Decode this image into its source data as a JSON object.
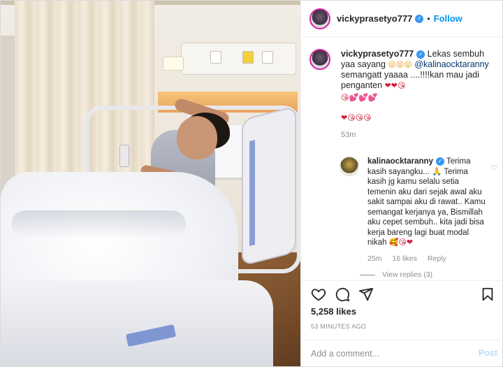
{
  "header": {
    "username": "vickyprasetyo777",
    "verified_glyph": "✓",
    "separator": "•",
    "follow_label": "Follow"
  },
  "caption": {
    "username": "vickyprasetyo777",
    "text_part1": " Lekas sembuh yaa sayang ",
    "emoji_line1": "😝😝😝",
    "mention": "@kalinaocktaranny",
    "text_part2": " semangatt yaaaa ....!!!!kan mau jadi penganten ",
    "emoji_line2": "❤❤😘",
    "emoji_line3": "😘💕💕💕",
    "emoji_line4": "❤😘😘😘",
    "time": "53m"
  },
  "reply": {
    "username": "kalinaocktaranny",
    "text": " Terima kasih sayangku... 🙏 Terima kasih jg kamu selalu setia temenin aku dari sejak awal aku sakit sampai aku di rawat.. Kamu semangat kerjanya ya, Bismillah aku cepet sembuh.. kita jadi bisa kerja bareng lagi buat modal nikah ",
    "emojis": "🥰😘❤",
    "time": "25m",
    "likes": "16 likes",
    "reply_label": "Reply",
    "heart_icon": "♡"
  },
  "view_replies": "View replies (3)",
  "actions": {
    "like_icon": "heart-outline",
    "comment_icon": "speech-bubble",
    "share_icon": "paper-plane",
    "save_icon": "bookmark"
  },
  "likes_count": "5,258 likes",
  "timestamp": "53 MINUTES AGO",
  "add_comment": {
    "placeholder": "Add a comment...",
    "post_label": "Post"
  }
}
